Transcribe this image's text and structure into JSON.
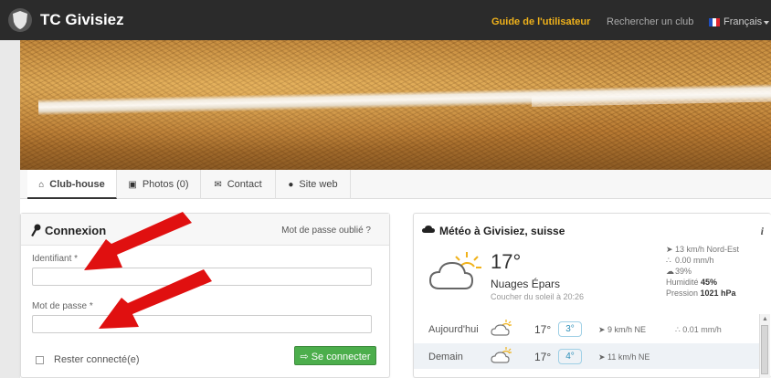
{
  "navbar": {
    "brand": "TC Givisiez",
    "guide_link": "Guide de l'utilisateur",
    "search_link": "Rechercher un club",
    "language": "Français"
  },
  "tabs": [
    {
      "label": "Club-house",
      "icon": "home-icon",
      "active": true
    },
    {
      "label": "Photos (0)",
      "icon": "image-icon",
      "active": false
    },
    {
      "label": "Contact",
      "icon": "envelope-icon",
      "active": false
    },
    {
      "label": "Site web",
      "icon": "globe-icon",
      "active": false
    }
  ],
  "login": {
    "title": "Connexion",
    "forgot_password": "Mot de passe oublié ?",
    "identifier_label": "Identifiant *",
    "identifier_value": "",
    "password_label": "Mot de passe *",
    "password_value": "",
    "remember_me": "Rester connecté(e)",
    "submit": "Se connecter"
  },
  "weather": {
    "title": "Météo à Givisiez, suisse",
    "current": {
      "temperature": "17°",
      "condition": "Nuages Épars",
      "sunset": "Coucher du soleil à 20:26",
      "wind": "13 km/h Nord-Est",
      "precipitation": "0.00 mm/h",
      "cloud_cover": "39%",
      "humidity_label": "Humidité",
      "humidity": "45%",
      "pressure_label": "Pression",
      "pressure": "1021 hPa"
    },
    "forecast": [
      {
        "day": "Aujourd'hui",
        "temp": "17°",
        "min": "3°",
        "wind": "9 km/h NE",
        "rain": "0.01 mm/h"
      },
      {
        "day": "Demain",
        "temp": "17°",
        "min": "4°",
        "wind": "11 km/h NE",
        "rain": ""
      }
    ]
  },
  "colors": {
    "navbar": "#2b2b2b",
    "guide_accent": "#f0b21b",
    "login_button": "#4cae4c",
    "annotation_arrow": "#e01010"
  }
}
